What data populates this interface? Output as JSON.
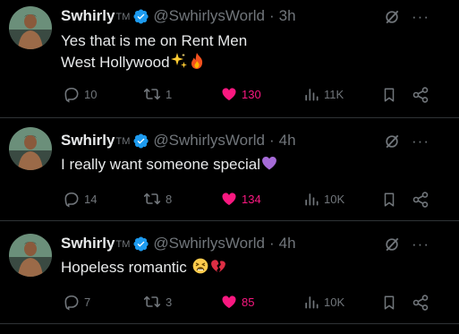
{
  "colors": {
    "background": "#000000",
    "text": "#e7e9ea",
    "muted": "#71767b",
    "like": "#f91880",
    "verified": "#1d9bf0",
    "divider": "#2f3336"
  },
  "tweets": [
    {
      "name": "Swhirly",
      "tm": "TM",
      "handle": "@SwhirlysWorld",
      "time": "3h",
      "text_line1": "Yes that is me on Rent Men",
      "text_line2": "West Hollywood",
      "emojis": [
        "sparkles",
        "fire"
      ],
      "replies": "10",
      "reposts": "1",
      "likes": "130",
      "views": "11K"
    },
    {
      "name": "Swhirly",
      "tm": "TM",
      "handle": "@SwhirlysWorld",
      "time": "4h",
      "text_line1": "I really want someone special",
      "emojis": [
        "purple-heart"
      ],
      "replies": "14",
      "reposts": "8",
      "likes": "134",
      "views": "10K"
    },
    {
      "name": "Swhirly",
      "tm": "TM",
      "handle": "@SwhirlysWorld",
      "time": "4h",
      "text_line1": "Hopeless romantic",
      "emojis": [
        "tired-face",
        "broken-heart"
      ],
      "replies": "7",
      "reposts": "3",
      "likes": "85",
      "views": "10K"
    }
  ],
  "icons": {
    "verified": "verified-badge-icon",
    "grok": "grok-icon",
    "more": "more-icon",
    "reply": "reply-icon",
    "repost": "repost-icon",
    "like": "heart-icon",
    "views": "views-icon",
    "bookmark": "bookmark-icon",
    "share": "share-icon"
  },
  "more_glyph": "···"
}
